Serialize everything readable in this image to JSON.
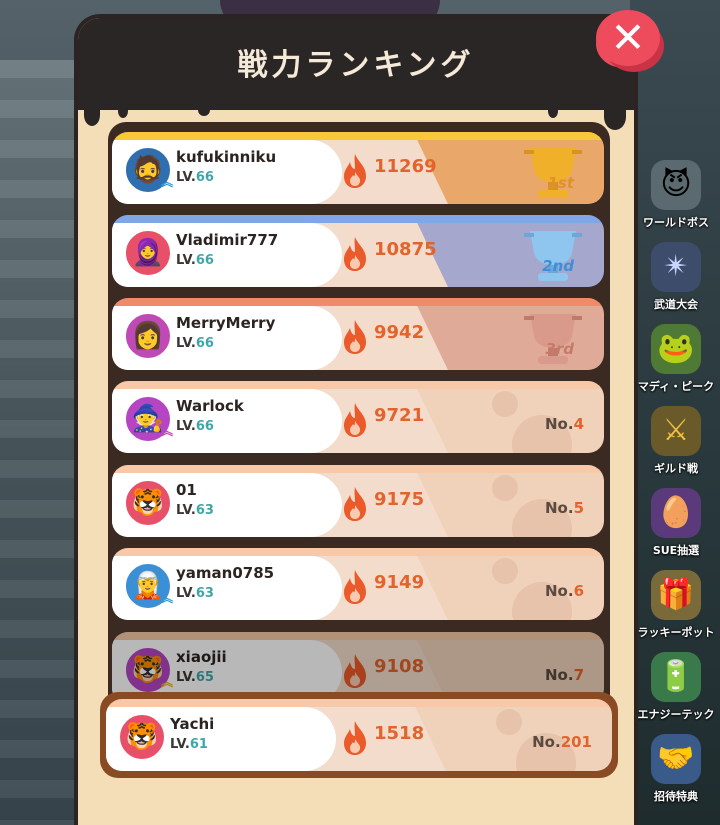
{
  "title": "戦力ランキング",
  "close_label": "✕",
  "level_prefix": "LV.",
  "no_prefix": "No.",
  "rows": [
    {
      "name": "kufukinniku",
      "level": "66",
      "power": "11269",
      "rank": "1st",
      "trophy_color": "#f0b02a",
      "avatar": "🧔",
      "avatar_bg": "#2f6fb0"
    },
    {
      "name": "Vladimir777",
      "level": "66",
      "power": "10875",
      "rank": "2nd",
      "trophy_color": "#8fc6ef",
      "avatar": "🧕",
      "avatar_bg": "#e8506a"
    },
    {
      "name": "MerryMerry",
      "level": "66",
      "power": "9942",
      "rank": "3rd",
      "trophy_color": "#d99a8c",
      "avatar": "👩",
      "avatar_bg": "#c04ab5"
    },
    {
      "name": "Warlock",
      "level": "66",
      "power": "9721",
      "rank": "4",
      "avatar": "🧙",
      "avatar_bg": "#b545c2"
    },
    {
      "name": "01",
      "level": "63",
      "power": "9175",
      "rank": "5",
      "avatar": "🐯",
      "avatar_bg": "#e8506a"
    },
    {
      "name": "yaman0785",
      "level": "63",
      "power": "9149",
      "rank": "6",
      "avatar": "🧝",
      "avatar_bg": "#3a8fd6"
    },
    {
      "name": "xiaojii",
      "level": "65",
      "power": "9108",
      "rank": "7",
      "avatar": "🐯",
      "avatar_bg": "#b545c2"
    }
  ],
  "self": {
    "name": "Yachi",
    "level": "61",
    "power": "1518",
    "rank": "201",
    "avatar": "🐯",
    "avatar_bg": "#e8506a"
  },
  "side_menu": [
    {
      "label": "ワールドボス",
      "icon": "😈"
    },
    {
      "label": "武道大会",
      "icon": "✴"
    },
    {
      "label": "マディ・ピーク",
      "icon": "🐸"
    },
    {
      "label": "ギルド戦",
      "icon": "⚔"
    },
    {
      "label": "SUE抽選",
      "icon": "🥚"
    },
    {
      "label": "ラッキーポット",
      "icon": "🎁"
    },
    {
      "label": "エナジーテック",
      "icon": "🔋"
    },
    {
      "label": "招待特典",
      "icon": "🤝"
    }
  ],
  "colors": {
    "accent": "#e2632b",
    "level": "#3fa7a7",
    "close": "#ee4b5c"
  }
}
